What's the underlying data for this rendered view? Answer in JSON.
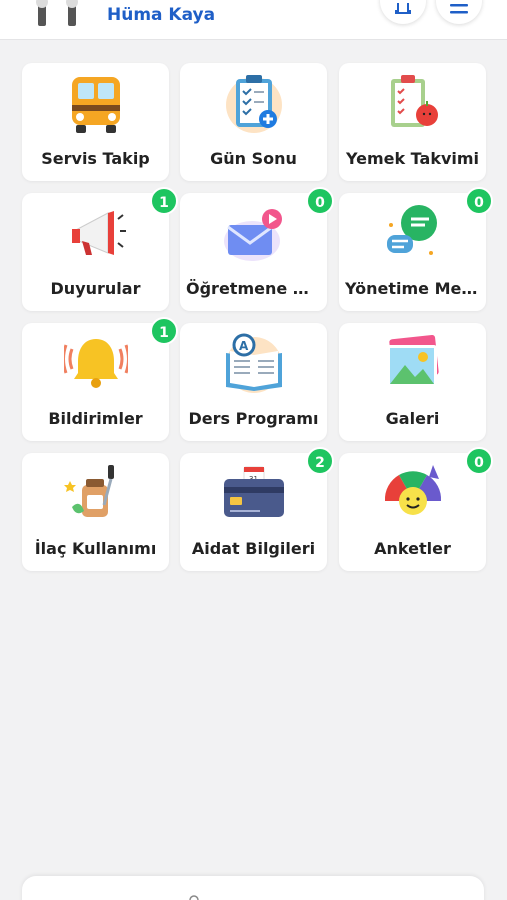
{
  "header": {
    "user_name": "Hüma Kaya",
    "icons": {
      "avatar": "family-avatar-icon",
      "bell": "bell-icon",
      "menu": "menu-icon"
    },
    "accent_color": "#1f5fc7"
  },
  "tiles": [
    {
      "label": "Servis Takip",
      "icon": "school-bus-icon",
      "badge": ""
    },
    {
      "label": "Gün Sonu",
      "icon": "clipboard-checklist-icon",
      "badge": ""
    },
    {
      "label": "Yemek Takvimi",
      "icon": "meal-clipboard-apple-icon",
      "badge": ""
    },
    {
      "label": "Duyurular",
      "icon": "megaphone-icon",
      "badge": "1"
    },
    {
      "label": "Öğretmene Mesaj",
      "icon": "envelope-send-icon",
      "badge": "0"
    },
    {
      "label": "Yönetime Mesaj",
      "icon": "chat-bubbles-icon",
      "badge": "0"
    },
    {
      "label": "Bildirimler",
      "icon": "bell-ringing-icon",
      "badge": "1"
    },
    {
      "label": "Ders Programı",
      "icon": "open-book-icon",
      "badge": ""
    },
    {
      "label": "Galeri",
      "icon": "photo-gallery-icon",
      "badge": ""
    },
    {
      "label": "İlaç Kullanımı",
      "icon": "medicine-bottle-icon",
      "badge": ""
    },
    {
      "label": "Aidat Bilgileri",
      "icon": "credit-card-icon",
      "badge": "2"
    },
    {
      "label": "Anketler",
      "icon": "survey-gauge-icon",
      "badge": "0"
    }
  ],
  "badge_color": "#1ec560"
}
